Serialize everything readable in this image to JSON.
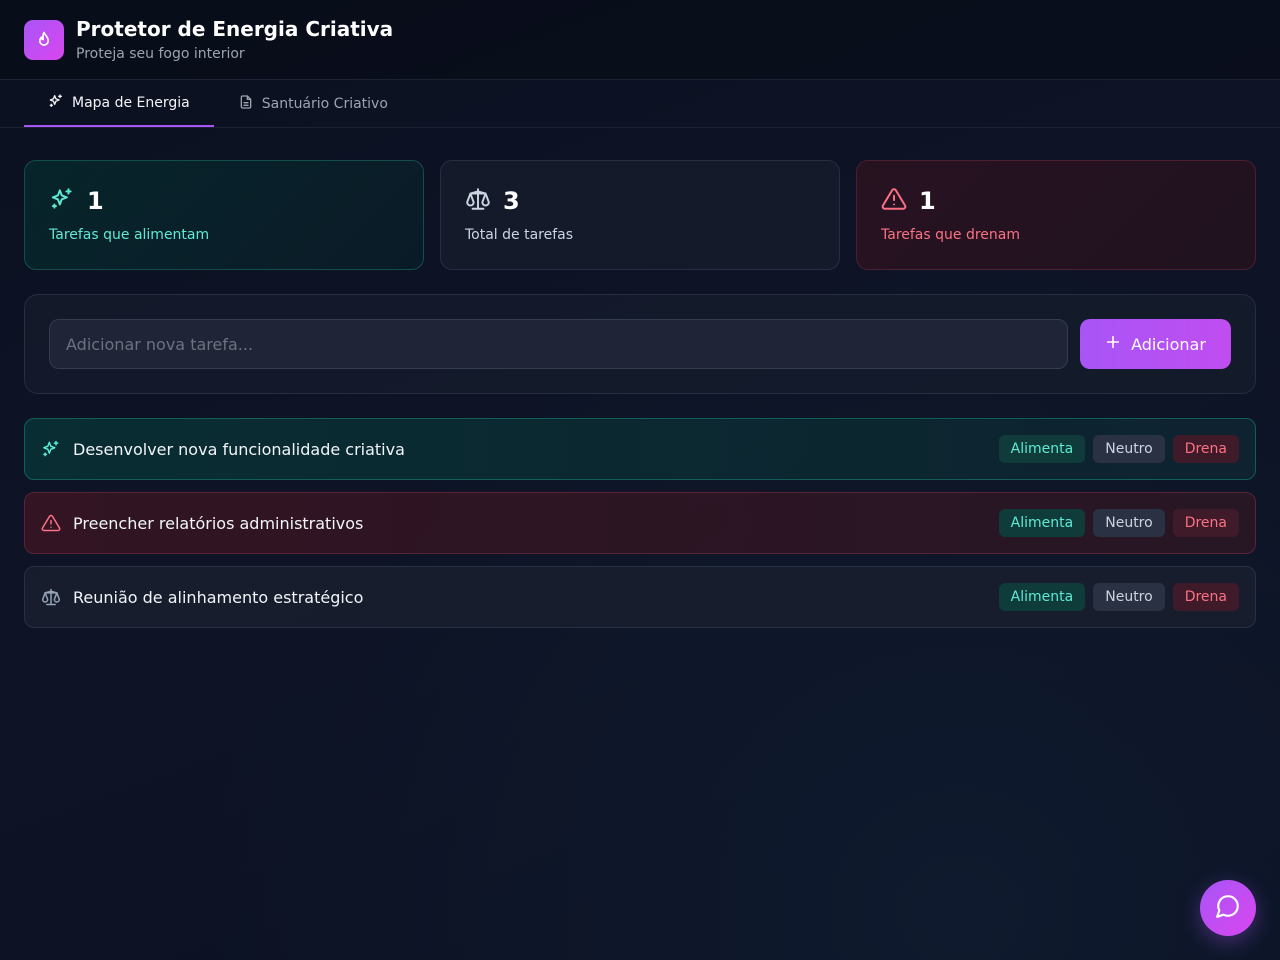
{
  "app": {
    "title": "Protetor de Energia Criativa",
    "subtitle": "Proteja seu fogo interior",
    "logo_icon": "flame-icon"
  },
  "tabs": [
    {
      "label": "Mapa de Energia",
      "icon": "sparkles-icon",
      "active": true
    },
    {
      "label": "Santuário Criativo",
      "icon": "document-icon",
      "active": false
    }
  ],
  "stats": [
    {
      "value": "1",
      "label": "Tarefas que alimentam",
      "icon": "sparkles-icon",
      "color": "#5eead4"
    },
    {
      "value": "3",
      "label": "Total de tarefas",
      "icon": "scale-icon",
      "color": "#cbd5e1"
    },
    {
      "value": "1",
      "label": "Tarefas que drenam",
      "icon": "warning-icon",
      "color": "#fb7185"
    }
  ],
  "add_task": {
    "placeholder": "Adicionar nova tarefa...",
    "value": "",
    "button_label": "Adicionar"
  },
  "chip_labels": {
    "feed": "Alimenta",
    "neutral": "Neutro",
    "drain": "Drena"
  },
  "tasks": [
    {
      "text": "Desenvolver nova funcionalidade criativa",
      "status": "feed",
      "icon": "sparkles-icon"
    },
    {
      "text": "Preencher relatórios administrativos",
      "status": "drain",
      "icon": "warning-icon"
    },
    {
      "text": "Reunião de alinhamento estratégico",
      "status": "neutral",
      "icon": "scale-icon"
    }
  ],
  "colors": {
    "accent": "#a855f7",
    "feed": "#5eead4",
    "drain": "#fb7185",
    "neutral": "#cbd5e1"
  },
  "chat": {
    "icon": "chat-bubble-icon"
  }
}
